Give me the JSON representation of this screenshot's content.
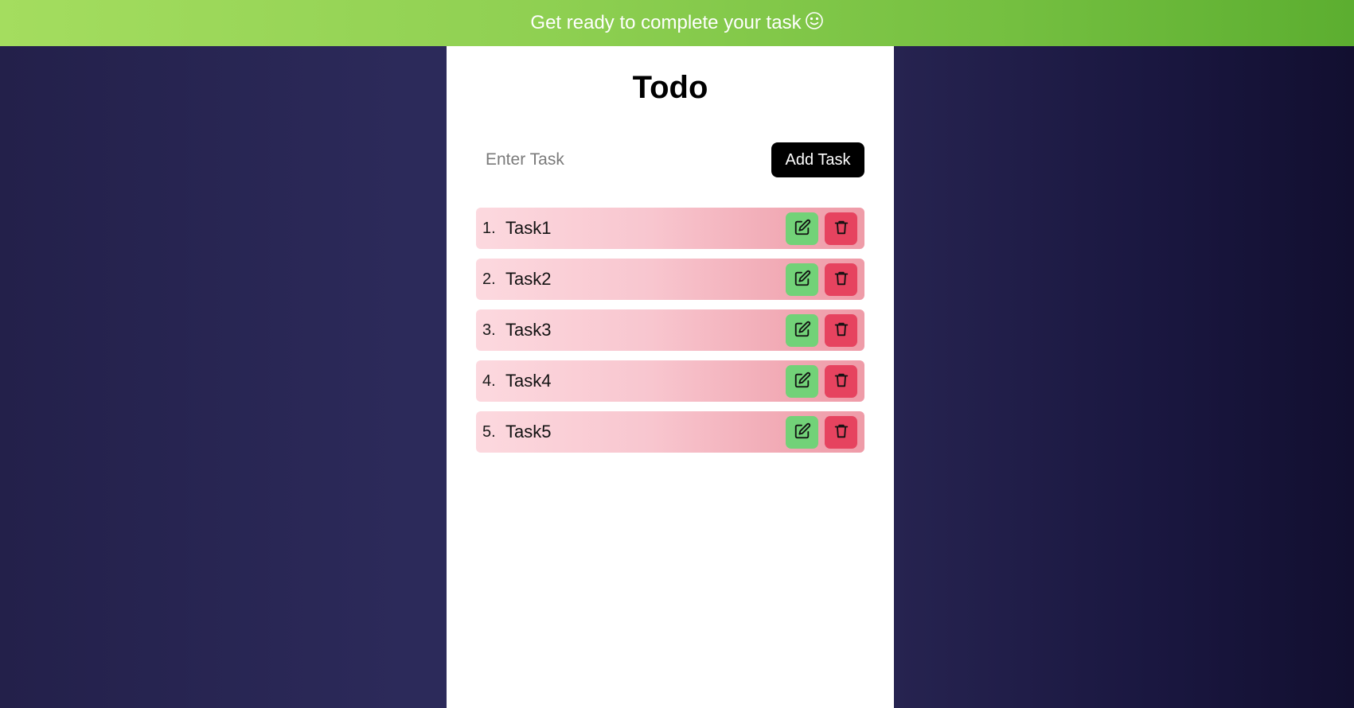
{
  "banner": {
    "text": "Get ready to complete your task",
    "icon": "smiley-icon"
  },
  "app": {
    "title": "Todo"
  },
  "input": {
    "placeholder": "Enter Task",
    "value": ""
  },
  "add_button": {
    "label": "Add Task"
  },
  "tasks": [
    {
      "number": "1.",
      "label": "Task1"
    },
    {
      "number": "2.",
      "label": "Task2"
    },
    {
      "number": "3.",
      "label": "Task3"
    },
    {
      "number": "4.",
      "label": "Task4"
    },
    {
      "number": "5.",
      "label": "Task5"
    }
  ],
  "row_actions": {
    "edit_icon": "edit-icon",
    "delete_icon": "trash-icon"
  },
  "colors": {
    "banner_start": "#a4dd5f",
    "banner_end": "#5cae30",
    "background": "#2a2755",
    "edit": "#72d278",
    "delete": "#e6435f",
    "row_start": "#fcd9df",
    "row_end": "#ef9ba8"
  }
}
